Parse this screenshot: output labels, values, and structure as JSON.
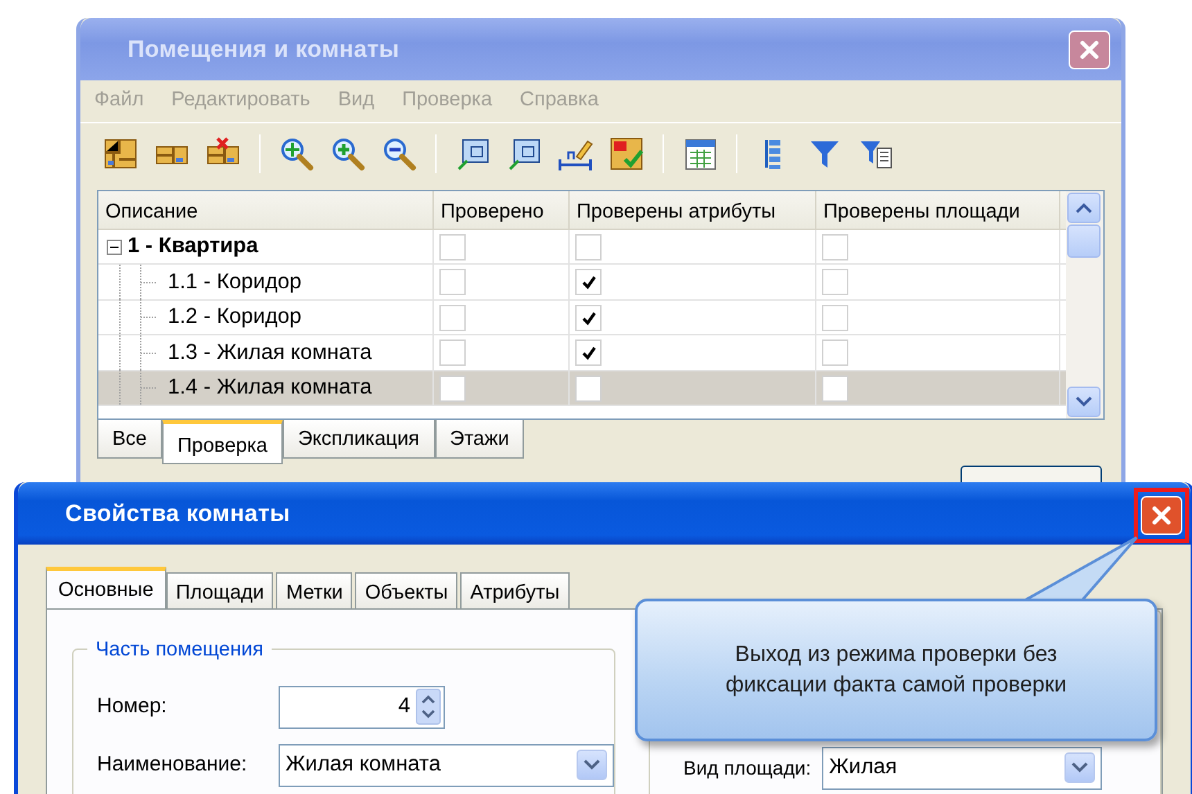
{
  "back_window": {
    "title": "Помещения и комнаты",
    "active": false,
    "menu": [
      "Файл",
      "Редактировать",
      "Вид",
      "Проверка",
      "Справка"
    ],
    "table": {
      "columns": [
        "Описание",
        "Проверено",
        "Проверены атрибуты",
        "Проверены площади"
      ],
      "rows": [
        {
          "label": "1 - Квартира",
          "expanded": true,
          "selected": false,
          "checks": [
            false,
            false,
            false
          ],
          "children": [
            {
              "label": "1.1 - Коридор",
              "selected": false,
              "checks": [
                false,
                true,
                false
              ]
            },
            {
              "label": "1.2 - Коридор",
              "selected": false,
              "checks": [
                false,
                true,
                false
              ]
            },
            {
              "label": "1.3 - Жилая комната",
              "selected": false,
              "checks": [
                false,
                true,
                false
              ]
            },
            {
              "label": "1.4 - Жилая комната",
              "selected": true,
              "checks": [
                false,
                false,
                false
              ]
            }
          ]
        }
      ]
    },
    "tabs": [
      {
        "label": "Все",
        "selected": false
      },
      {
        "label": "Проверка",
        "selected": true
      },
      {
        "label": "Экспликация",
        "selected": false
      },
      {
        "label": "Этажи",
        "selected": false
      }
    ]
  },
  "dialog": {
    "title": "Свойства комнаты",
    "active": true,
    "tabs": [
      {
        "label": "Основные",
        "selected": true
      },
      {
        "label": "Площади",
        "selected": false
      },
      {
        "label": "Метки",
        "selected": false
      },
      {
        "label": "Объекты",
        "selected": false
      },
      {
        "label": "Атрибуты",
        "selected": false
      }
    ],
    "group_title": "Часть помещения",
    "fields": [
      {
        "kind": "spin",
        "label": "Номер:",
        "value": "4"
      },
      {
        "kind": "select",
        "label": "Наименование:",
        "value": "Жилая комната"
      }
    ],
    "area_type": {
      "label": "Вид площади:",
      "value": "Жилая"
    }
  },
  "callout": {
    "text": "Выход из режима проверки без фиксации факта самой проверки"
  }
}
